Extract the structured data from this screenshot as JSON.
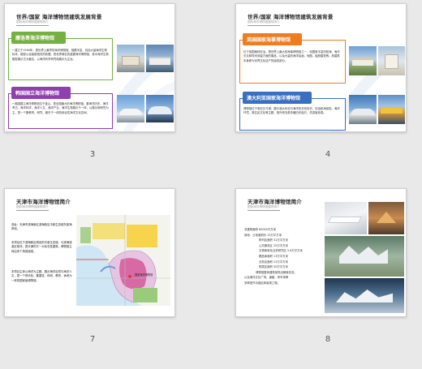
{
  "slides": [
    {
      "number": "3",
      "title": "世界/国家 海洋博物馆建筑发展背景",
      "subtitle": "国际海洋博物馆建筑简介",
      "sections": [
        {
          "label": "摩洛哥海洋博物馆",
          "color": "#76b043",
          "body": "• 建立于1960年，是世界上最早的海洋博物馆。馆藏丰富，包括大量海洋生物标本、模型以及船舶相关的收藏。是世界闻名的重要海洋博物馆，其中海洋生物模型展示尤为著名，以海洋科学研究和展示为主旨。"
        },
        {
          "label": "韩国国立海洋博物馆",
          "color": "#8e3fb0",
          "body": "• 韩国国立海洋博物馆位于釜山，是全国最大的海洋博物馆。集海洋历史、海洋考古、海洋科学、海洋人文、海洋产业、海洋生物展示于一体，以展示和研究为主，是一个集教育、研究、娱乐于一体的综合性海洋文化空间。"
        }
      ]
    },
    {
      "number": "4",
      "title": "世界/国家 海洋博物馆建筑发展背景",
      "subtitle": "国际海洋博物馆建筑简介",
      "sections": [
        {
          "label": "英国国家海事博物馆",
          "color": "#f07c22",
          "body": "位于英国格林尼治，是世界上最大的海事博物馆之一，收藏着丰富的航海、海洋天文和时间测量方面的展品，以及大量的海洋绘画、地图、船舶模型等。其建筑本身即为世界文化遗产的组成部分。"
        },
        {
          "label": "澳大利亚国家海洋博物馆",
          "color": "#3a6fc0",
          "body": "博物馆位于悉尼达令港，展示澳大利亚与海洋的关系历史，包括航海探险、海洋环境、原住民文化等主题，馆外停泊着多艘历史船只，供游客参观。"
        }
      ]
    },
    {
      "number": "7",
      "title": "天津市海洋博物馆简介",
      "subtitle": "国际海洋博物馆建筑简介",
      "paragraphs": [
        "选址：天津市滨海新区滨海新区中新生态城东部海岸线。",
        "本项目位于滨海新区规划的中新生态城，与滨海旅游区相邻，是天津的又一大标志性建筑。博物馆主体由多个场馆组成。",
        "本项目主体以海洋为主题，展示海洋自然与海洋人文，是一个现代化、集展览、科研、教育、休闲为一体的国家级博物馆。"
      ],
      "map_label": "国家海洋博物馆"
    },
    {
      "number": "8",
      "title": "天津市海洋博物馆简介",
      "subtitle": "国际海洋博物馆建筑简介",
      "stats": [
        "总建筑面积 80000平方米",
        "用地：占地面积约 15万平方米",
        "陈列区面积 31万平方米",
        "公共服务区 20万平方米",
        "文物库房及业务研究区 5.6万平方米",
        "藏品库面积 13万平方米",
        "业务区面积 22万平方米",
        "附属区面积 30万平方米",
        "博物馆整体建筑呈现出鲸鱼形态，",
        "以及海洋文化广场、道路、停车场等",
        "多种室外功能区和景观工程。"
      ]
    }
  ]
}
